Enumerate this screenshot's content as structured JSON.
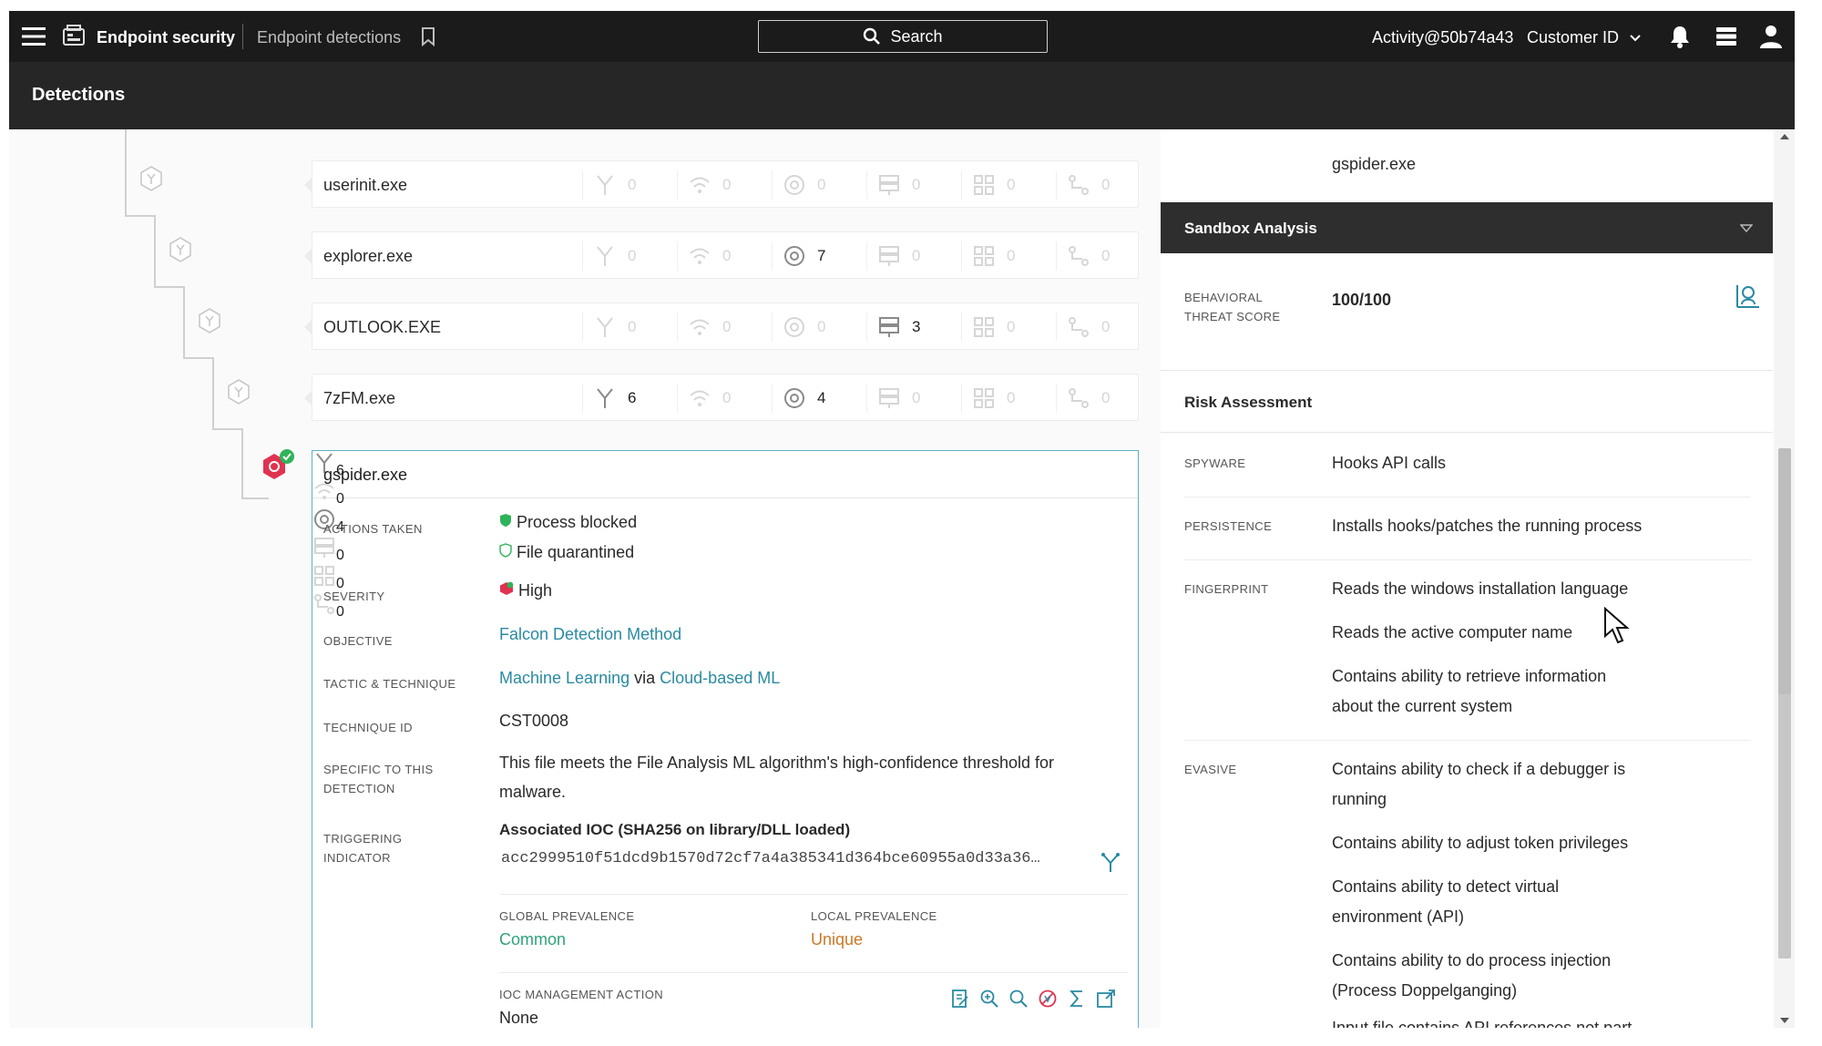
{
  "topbar": {
    "brand": "Endpoint security",
    "breadcrumb": "Endpoint detections",
    "search_label": "Search",
    "account": "Activity@50b74a43",
    "customer": "Customer ID"
  },
  "page_title": "Detections",
  "tree_rows": [
    {
      "name": "userinit.exe",
      "counts": [
        "0",
        "0",
        "0",
        "0",
        "0",
        "0"
      ]
    },
    {
      "name": "explorer.exe",
      "counts": [
        "0",
        "0",
        "7",
        "0",
        "0",
        "0"
      ]
    },
    {
      "name": "OUTLOOK.EXE",
      "counts": [
        "0",
        "0",
        "0",
        "3",
        "0",
        "0"
      ]
    },
    {
      "name": "7zFM.exe",
      "counts": [
        "6",
        "0",
        "4",
        "0",
        "0",
        "0"
      ]
    }
  ],
  "selected": {
    "name": "gspider.exe",
    "counts": [
      "6",
      "0",
      "4",
      "0",
      "0",
      "0"
    ],
    "labels": {
      "actions": "ACTIONS TAKEN",
      "severity": "SEVERITY",
      "objective": "OBJECTIVE",
      "tactic": "TACTIC & TECHNIQUE",
      "technique_id": "TECHNIQUE ID",
      "specific_1": "SPECIFIC TO THIS",
      "specific_2": "DETECTION",
      "trigger_1": "TRIGGERING",
      "trigger_2": "INDICATOR",
      "global_prev": "GLOBAL PREVALENCE",
      "local_prev": "LOCAL PREVALENCE",
      "ioc_action": "IOC MANAGEMENT ACTION"
    },
    "action_1": "Process blocked",
    "action_2": "File quarantined",
    "severity": "High",
    "objective": "Falcon Detection Method",
    "tactic": "Machine Learning",
    "tactic_via": "via",
    "technique": "Cloud-based ML",
    "technique_id": "CST0008",
    "specific_line1": "This file meets the File Analysis ML algorithm's high-confidence threshold for",
    "specific_line2": "malware.",
    "ioc_title": "Associated IOC (SHA256 on library/DLL loaded)",
    "ioc_hash": "acc2999510f51dcd9b1570d72cf7a4a385341d364bce60955a0d33a36…",
    "global_prevalence": "Common",
    "local_prevalence": "Unique",
    "ioc_management_action": "None"
  },
  "right": {
    "file_name": "gspider.exe",
    "sandbox_title": "Sandbox Analysis",
    "score_label_1": "BEHAVIORAL",
    "score_label_2": "THREAT SCORE",
    "score": "100/100",
    "risk_title": "Risk Assessment",
    "risk": [
      {
        "label": "SPYWARE",
        "items": [
          "Hooks API calls"
        ]
      },
      {
        "label": "PERSISTENCE",
        "items": [
          "Installs hooks/patches the running process"
        ]
      },
      {
        "label": "FINGERPRINT",
        "items": [
          "Reads the windows installation language",
          "Reads the active computer name",
          "Contains ability to retrieve information",
          "about the current system"
        ]
      },
      {
        "label": "EVASIVE",
        "items": [
          "Contains ability to check if a debugger is",
          "running",
          "Contains ability to adjust token privileges",
          "Contains ability to detect virtual",
          "environment (API)",
          "Contains ability to do process injection",
          "(Process Doppelganging)",
          "Input file contains API references not part"
        ]
      }
    ]
  },
  "colors": {
    "accent": "#2a8aa2",
    "selected_border": "#5ab4c6",
    "severity_high": "#e0334f",
    "success": "#2fb35a",
    "unique": "#c9792a",
    "topbar": "#1b1b1b"
  }
}
